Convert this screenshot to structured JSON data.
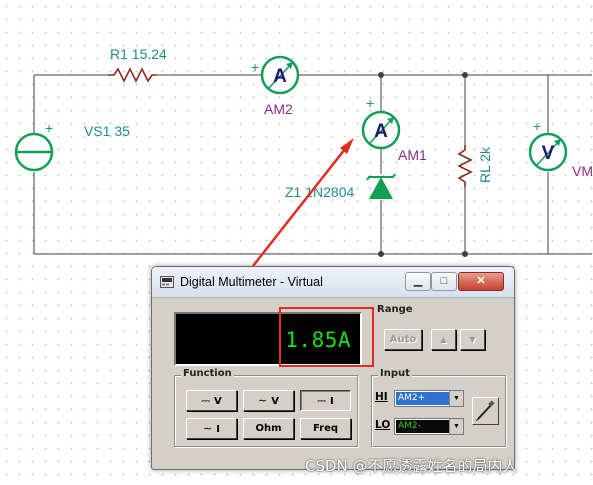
{
  "schematic": {
    "vs1_label": "VS1 35",
    "r1_label": "R1 15.24",
    "am2_label": "AM2",
    "am1_label": "AM1",
    "z1_label": "Z1 1N2804",
    "rl_label": "RL 2k",
    "vm_label": "VM",
    "ammeter_letter": "A",
    "voltmeter_letter": "V",
    "plus": "+"
  },
  "window": {
    "title": "Digital Multimeter - Virtual",
    "min_label": "▁",
    "max_label": "□",
    "close_label": "✕"
  },
  "display": {
    "reading": "1.85A"
  },
  "range": {
    "title": "Range",
    "auto_label": "Auto",
    "up_label": "▲",
    "down_label": "▼"
  },
  "function": {
    "title": "Function",
    "dcv_label": "V",
    "acv_label": "V",
    "dci_label": "I",
    "aci_label": "I",
    "ohm_label": "Ohm",
    "freq_label": "Freq",
    "dc_symbol": "⎓",
    "ac_symbol": "∼"
  },
  "input": {
    "title": "Input",
    "hi_label": "HI",
    "lo_label": "LO",
    "hi_value": "AM2+",
    "lo_value": "AM2-",
    "hi_bg": "#2f6fd6",
    "lo_bg": "#0a0a0a",
    "lo_text_color": "#1ed61e"
  },
  "colors": {
    "wire": "#404040",
    "label_teal": "#1f8d8d",
    "label_purple": "#8a2a8a",
    "meter_green": "#0f9f55",
    "meter_letter": "#1a1a6e",
    "highlight_red": "#e52a1f"
  },
  "watermark": "CSDN @不愿透露姓名的局内人"
}
